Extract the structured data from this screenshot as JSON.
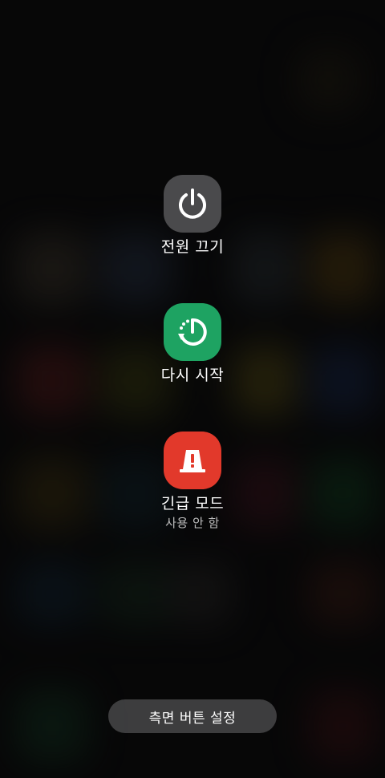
{
  "power_menu": {
    "power_off": {
      "label": "전원 끄기",
      "icon": "power-icon",
      "color": "#4a4a4c"
    },
    "restart": {
      "label": "다시 시작",
      "icon": "restart-icon",
      "color": "#1ea362"
    },
    "emergency": {
      "label": "긴급 모드",
      "status": "사용 안 함",
      "icon": "emergency-light-icon",
      "color": "#e2392b"
    }
  },
  "side_button_settings": {
    "label": "측면 버튼 설정"
  }
}
